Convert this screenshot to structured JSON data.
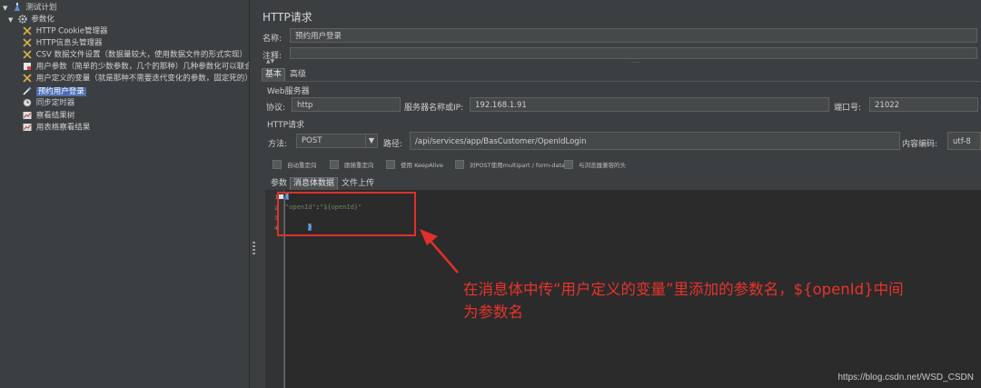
{
  "tree": {
    "items": [
      {
        "label": "测试计划",
        "icon": "test-plan-icon"
      },
      {
        "label": "参数化",
        "icon": "thread-group-gear-icon"
      },
      {
        "label": "HTTP Cookie管理器",
        "icon": "config-wrench-icon"
      },
      {
        "label": "HTTP信息头管理器",
        "icon": "config-wrench-icon"
      },
      {
        "label": "CSV 数据文件设置（数据量较大，使用数据文件的形式实现）",
        "icon": "config-wrench-icon"
      },
      {
        "label": "用户参数（简单的少数参数，几个的那种）几种参数化可以联合",
        "icon": "preprocessor-icon"
      },
      {
        "label": "用户定义的变量（就是那种不需要迭代变化的参数，固定死的）",
        "icon": "config-wrench-icon"
      },
      {
        "label": "预约用户登录",
        "icon": "sampler-pen-icon"
      },
      {
        "label": "同步定时器",
        "icon": "timer-clock-icon"
      },
      {
        "label": "察看结果树",
        "icon": "listener-chart-icon"
      },
      {
        "label": "用表格察看结果",
        "icon": "listener-chart-icon"
      }
    ]
  },
  "panel": {
    "title": "HTTP请求",
    "name_label": "名称:",
    "name_value": "预约用户登录",
    "comment_label": "注释:",
    "tabs": [
      "基本",
      "高级"
    ],
    "web_server_group": "Web服务器",
    "protocol_label": "协议:",
    "protocol_value": "http",
    "server_label": "服务器名称或IP:",
    "server_value": "192.168.1.91",
    "port_label": "端口号:",
    "port_value": "21022",
    "http_request_group": "HTTP请求",
    "method_label": "方法:",
    "method_value": "POST",
    "path_label": "路径:",
    "path_value": "/api/services/app/BasCustomer/OpenIdLogin",
    "encoding_label": "内容编码:",
    "encoding_value": "utf-8",
    "checkboxes": [
      "自动重定向",
      "跟随重定向",
      "使用 KeepAlive",
      "对POST使用multipart / form-data",
      "与浏览器兼容的头"
    ],
    "body_tabs": [
      "参数",
      "消息体数据",
      "文件上传"
    ]
  },
  "editor": {
    "line_numbers": [
      "1",
      "2",
      "3",
      "4"
    ],
    "open_brace": "{",
    "line2_key": "\"openId\"",
    "line2_colon": ":",
    "line2_value": "\"${openId}\"",
    "close_brace": "}"
  },
  "annotation": {
    "line1": "在消息体中传“用户定义的变量”里添加的参数名，${openId}中间",
    "line2": "为参数名"
  },
  "watermark": "https://blog.csdn.net/WSD_CSDN",
  "colors": {
    "background": "#3c3f41",
    "selection": "#4b6eaf",
    "annotation_red": "#e8332c",
    "json_green": "#6a8759"
  }
}
